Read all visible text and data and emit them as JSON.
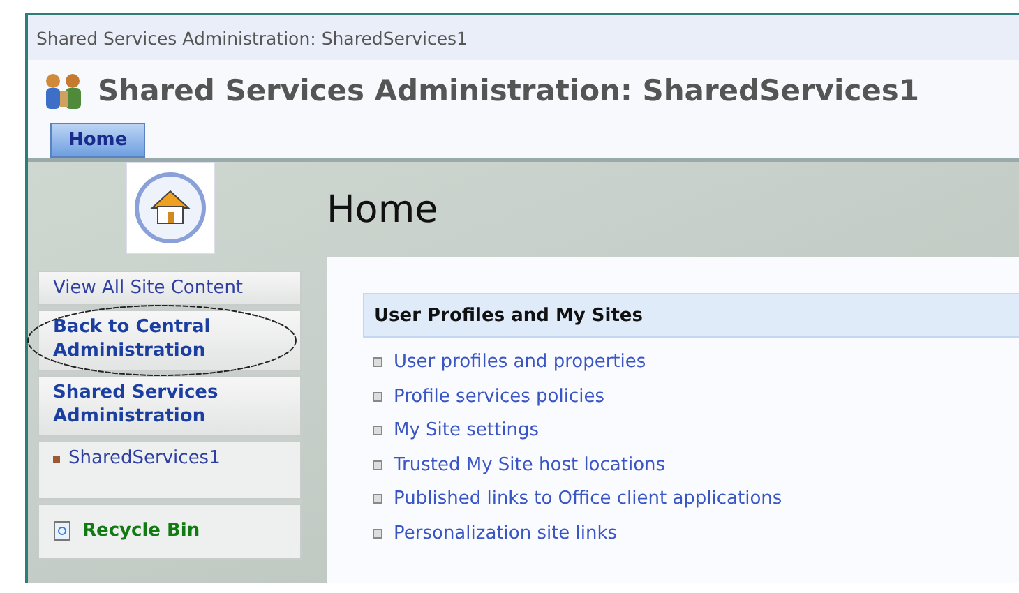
{
  "breadcrumb": "Shared Services Administration: SharedServices1",
  "site_title": "Shared Services Administration: SharedServices1",
  "tabs": [
    {
      "label": "Home",
      "selected": true
    }
  ],
  "page_title": "Home",
  "quick_launch": [
    {
      "kind": "link",
      "label": "View All Site Content",
      "circled": false
    },
    {
      "kind": "heading",
      "label": "Back to Central Administration",
      "circled": true
    },
    {
      "kind": "heading",
      "label": "Shared Services Administration",
      "circled": false
    },
    {
      "kind": "sub",
      "label": "SharedServices1",
      "circled": false
    },
    {
      "kind": "recycle",
      "label": "Recycle Bin",
      "circled": false
    }
  ],
  "section": {
    "title": "User Profiles and My Sites",
    "links": [
      "User profiles and properties",
      "Profile services policies",
      "My Site settings",
      "Trusted My Site host locations",
      "Published links to Office client applications",
      "Personalization site links"
    ]
  }
}
